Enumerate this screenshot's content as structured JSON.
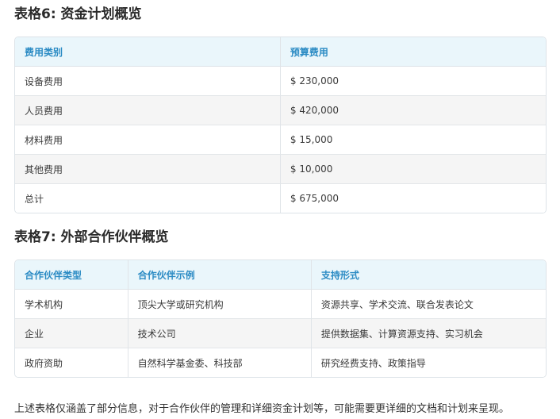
{
  "table6": {
    "title": "表格6: 资金计划概览",
    "headers": [
      "费用类别",
      "预算费用"
    ],
    "rows": [
      [
        "设备费用",
        "$ 230,000"
      ],
      [
        "人员费用",
        "$ 420,000"
      ],
      [
        "材料费用",
        "$ 15,000"
      ],
      [
        "其他费用",
        "$ 10,000"
      ],
      [
        "总计",
        "$ 675,000"
      ]
    ]
  },
  "table7": {
    "title": "表格7: 外部合作伙伴概览",
    "headers": [
      "合作伙伴类型",
      "合作伙伴示例",
      "支持形式"
    ],
    "rows": [
      [
        "学术机构",
        "顶尖大学或研究机构",
        "资源共享、学术交流、联合发表论文"
      ],
      [
        "企业",
        "技术公司",
        "提供数据集、计算资源支持、实习机会"
      ],
      [
        "政府资助",
        "自然科学基金委、科技部",
        "研究经费支持、政策指导"
      ]
    ]
  },
  "note": "上述表格仅涵盖了部分信息，对于合作伙伴的管理和详细资金计划等，可能需要更详细的文档和计划来呈现。",
  "colors": {
    "header_bg": "#eaf6fb",
    "header_text": "#2b8bc4",
    "stripe_bg": "#f5f5f5",
    "border": "#dde3e8"
  }
}
